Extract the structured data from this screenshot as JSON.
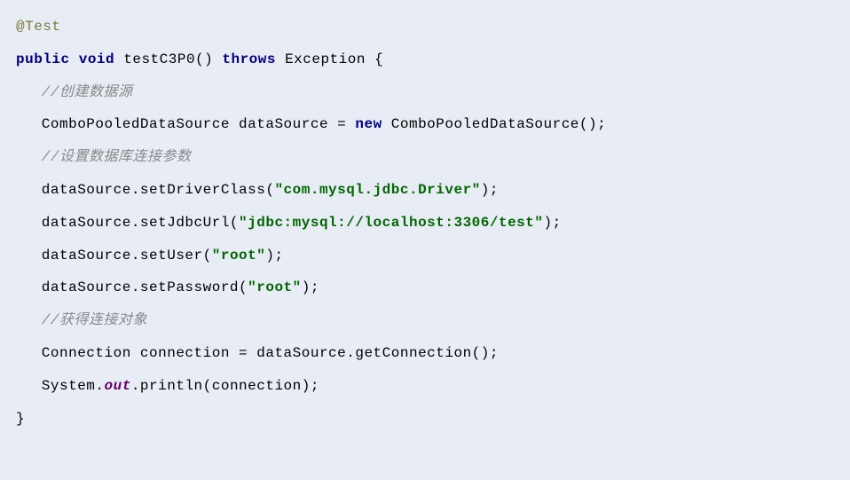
{
  "line1": {
    "annotation": "@Test"
  },
  "line2": {
    "public": "public",
    "void": "void",
    "space": " ",
    "method": "testC3P0() ",
    "throws": "throws",
    "exception": " Exception {"
  },
  "line3": {
    "comment": "//创建数据源"
  },
  "line4": {
    "p1": "ComboPooledDataSource dataSource = ",
    "kw": "new",
    "p2": " ComboPooledDataSource();"
  },
  "line5": {
    "comment": "//设置数据库连接参数"
  },
  "line6": {
    "p1": "dataSource.setDriverClass(",
    "str": "\"com.mysql.jdbc.Driver\"",
    "p2": ");"
  },
  "line7": {
    "p1": "dataSource.setJdbcUrl(",
    "str": "\"jdbc:mysql://localhost:3306/test\"",
    "p2": ");"
  },
  "line8": {
    "p1": "dataSource.setUser(",
    "str": "\"root\"",
    "p2": ");"
  },
  "line9": {
    "p1": "dataSource.setPassword(",
    "str": "\"root\"",
    "p2": ");"
  },
  "line10": {
    "comment": "//获得连接对象"
  },
  "line11": {
    "p1": "Connection connection = dataSource.getConnection();"
  },
  "line12": {
    "p1": "System.",
    "out": "out",
    "p2": ".println(connection);"
  },
  "line13": {
    "brace": "}"
  }
}
